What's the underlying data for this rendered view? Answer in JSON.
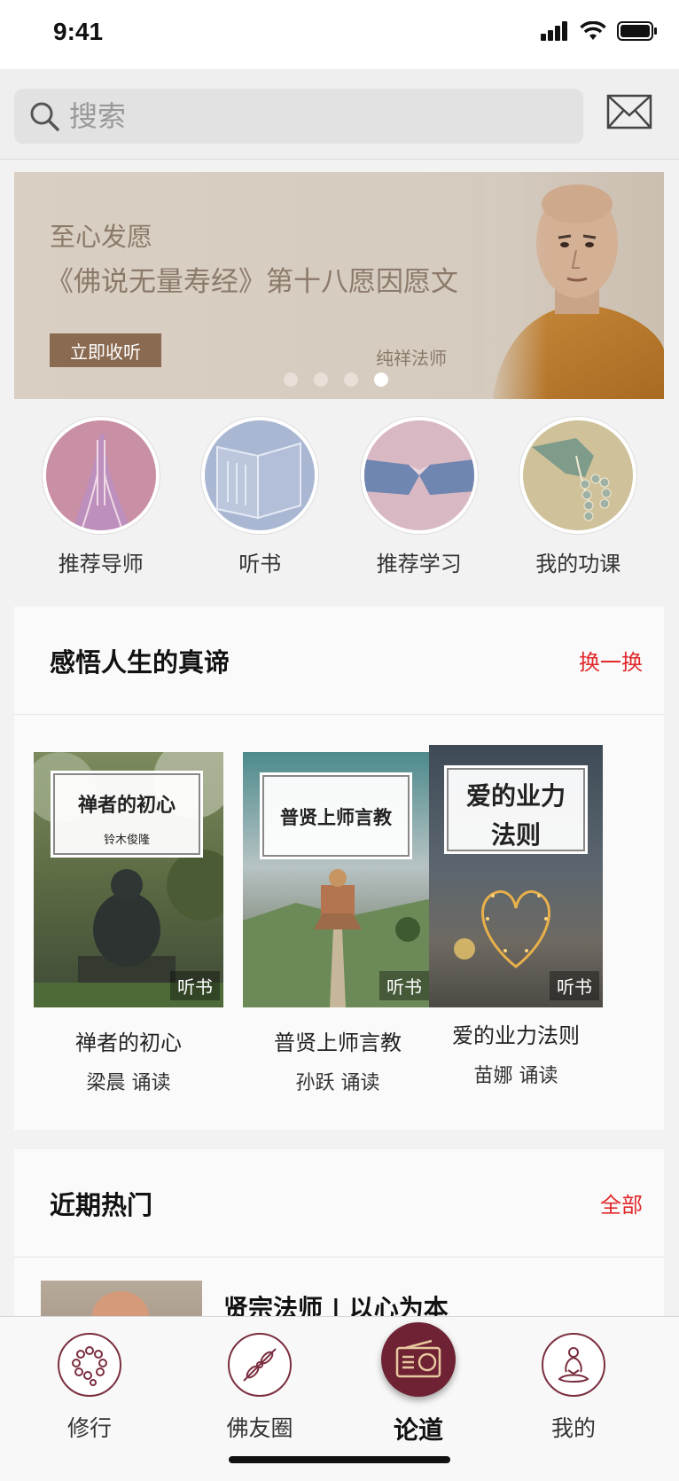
{
  "status_bar": {
    "time": "9:41"
  },
  "search": {
    "placeholder": "搜索"
  },
  "banner": {
    "subtitle": "至心发愿",
    "title": "《佛说无量寿经》第十八愿因愿文",
    "button_label": "立即收听",
    "master_name": "纯祥法师",
    "dots_count": 4,
    "active_dot": 4
  },
  "categories": [
    {
      "label": "推荐导师",
      "icon": "praying-hands-icon",
      "color": "#c98fa5"
    },
    {
      "label": "听书",
      "icon": "open-book-icon",
      "color": "#a9b7d3"
    },
    {
      "label": "推荐学习",
      "icon": "joined-hands-icon",
      "color": "#d8b8c2"
    },
    {
      "label": "我的功课",
      "icon": "prayer-beads-hand-icon",
      "color": "#cfc29a"
    }
  ],
  "section_truth": {
    "title": "感悟人生的真谛",
    "action": "换一换",
    "books": [
      {
        "cover_title": "禅者的初心",
        "cover_author": "铃木俊隆",
        "tag": "听书",
        "name": "禅者的初心",
        "reader": "梁晨  诵读"
      },
      {
        "cover_title": "普贤上师言教",
        "tag": "听书",
        "name": "普贤上师言教",
        "reader": "孙跃  诵读"
      },
      {
        "cover_title_line1": "爱的业力",
        "cover_title_line2": "法则",
        "tag": "听书",
        "name": "爱的业力法则",
        "reader": "苗娜  诵读"
      }
    ]
  },
  "section_hot": {
    "title": "近期热门",
    "action": "全部",
    "first_item_title": "贤宗法师 | 以心为本"
  },
  "tabbar": {
    "tabs": [
      {
        "label": "修行",
        "icon": "prayer-beads-icon"
      },
      {
        "label": "佛友圈",
        "icon": "vajra-icon"
      },
      {
        "label": "论道",
        "icon": "radio-icon",
        "active": true
      },
      {
        "label": "我的",
        "icon": "meditating-person-icon"
      }
    ]
  },
  "colors": {
    "accent_red": "#e2282b",
    "tab_maroon": "#6e2233",
    "banner_button": "#8a6a50"
  }
}
